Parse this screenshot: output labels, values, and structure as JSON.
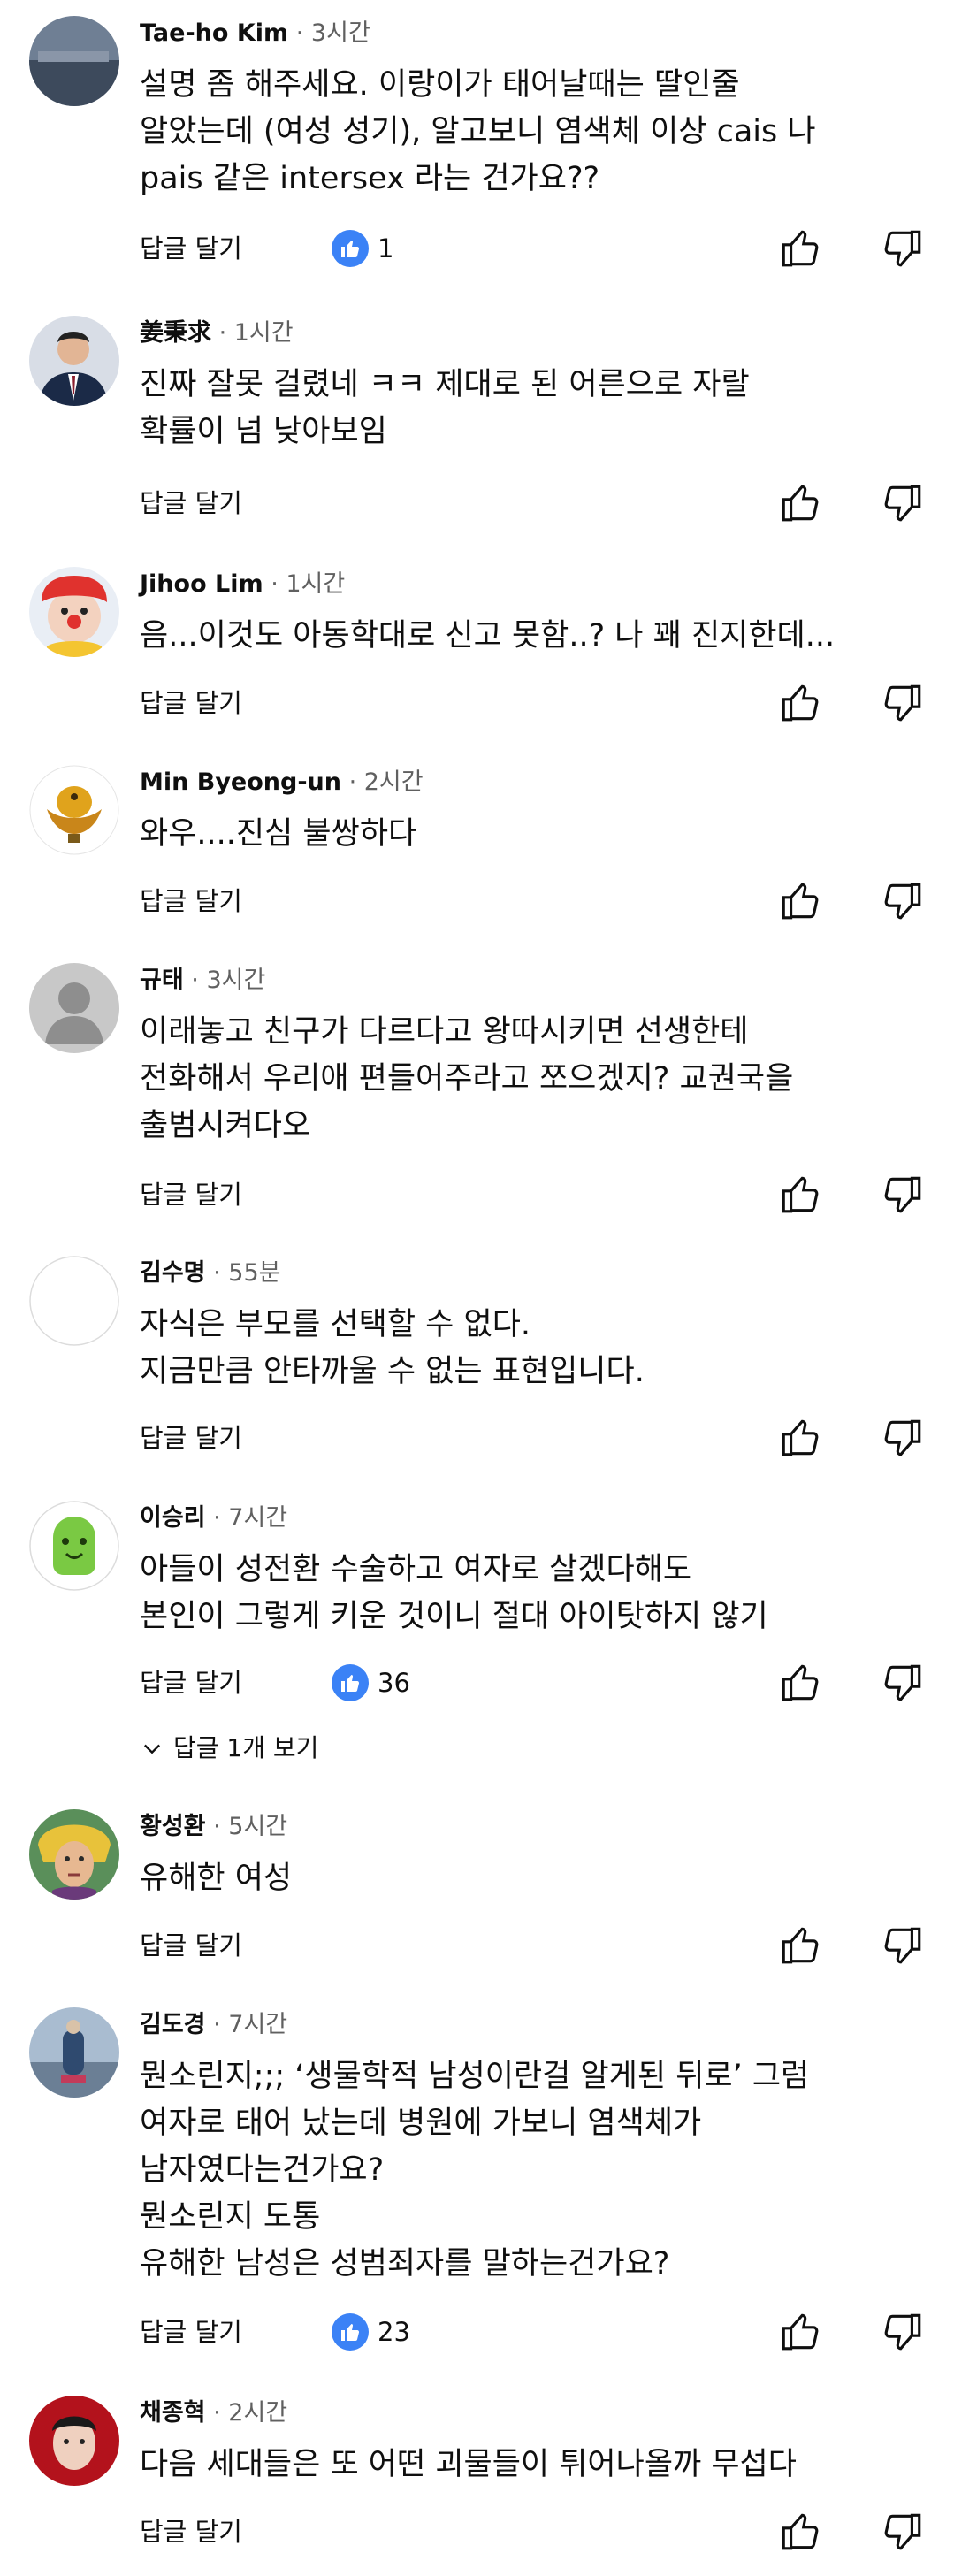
{
  "reply_label": "답글 달기",
  "view_replies_label": "답글 1개 보기",
  "colors": {
    "like_badge": "#3b82f6",
    "meta_gray": "#606060"
  },
  "comments": [
    {
      "author": "Tae-ho Kim",
      "time": "· 3시간",
      "lines": [
        "설명 좀 해주세요. 이랑이가 태어날때는 딸인줄",
        "알았는데 (여성 성기), 알고보니 염색체 이상 cais 나",
        "pais 같은 intersex 라는 건가요??"
      ],
      "likes": "1"
    },
    {
      "author": "姜秉求",
      "time": "· 1시간",
      "lines": [
        "진짜 잘못 걸렸네 ㅋㅋ 제대로 된 어른으로 자랄",
        "확률이 넘 낮아보임"
      ]
    },
    {
      "author": "Jihoo Lim",
      "time": "· 1시간",
      "lines": [
        "음...이것도 아동학대로 신고 못함..? 나 꽤 진지한데..."
      ]
    },
    {
      "author": "Min Byeong-un",
      "time": "· 2시간",
      "lines": [
        "와우....진심 불쌍하다"
      ]
    },
    {
      "author": "규태",
      "time": "· 3시간",
      "lines": [
        "이래놓고 친구가 다르다고 왕따시키면 선생한테",
        "전화해서 우리애 편들어주라고 쪼으겠지? 교권국을",
        "출범시켜다오"
      ]
    },
    {
      "author": "김수명",
      "time": "· 55분",
      "lines": [
        "자식은 부모를 선택할 수 없다.",
        "지금만큼 안타까울 수 없는 표현입니다."
      ]
    },
    {
      "author": "이승리",
      "time": "· 7시간",
      "lines": [
        "아들이 성전환 수술하고 여자로 살겠다해도",
        "본인이 그렇게 키운 것이니 절대 아이탓하지 않기"
      ],
      "likes": "36",
      "has_replies": true
    },
    {
      "author": "황성환",
      "time": "· 5시간",
      "lines": [
        "유해한 여성"
      ]
    },
    {
      "author": "김도경",
      "time": "· 7시간",
      "lines": [
        "뭔소린지;;; ‘생물학적 남성이란걸 알게된 뒤로’ 그럼",
        "여자로 태어 났는데 병원에 가보니 염색체가",
        "남자였다는건가요?",
        "뭔소린지 도통",
        "유해한 남성은 성범죄자를 말하는건가요?"
      ],
      "likes": "23"
    },
    {
      "author": "채종혁",
      "time": "· 2시간",
      "lines": [
        "다음 세대들은 또 어떤 괴물들이 튀어나올까 무섭다"
      ]
    }
  ]
}
